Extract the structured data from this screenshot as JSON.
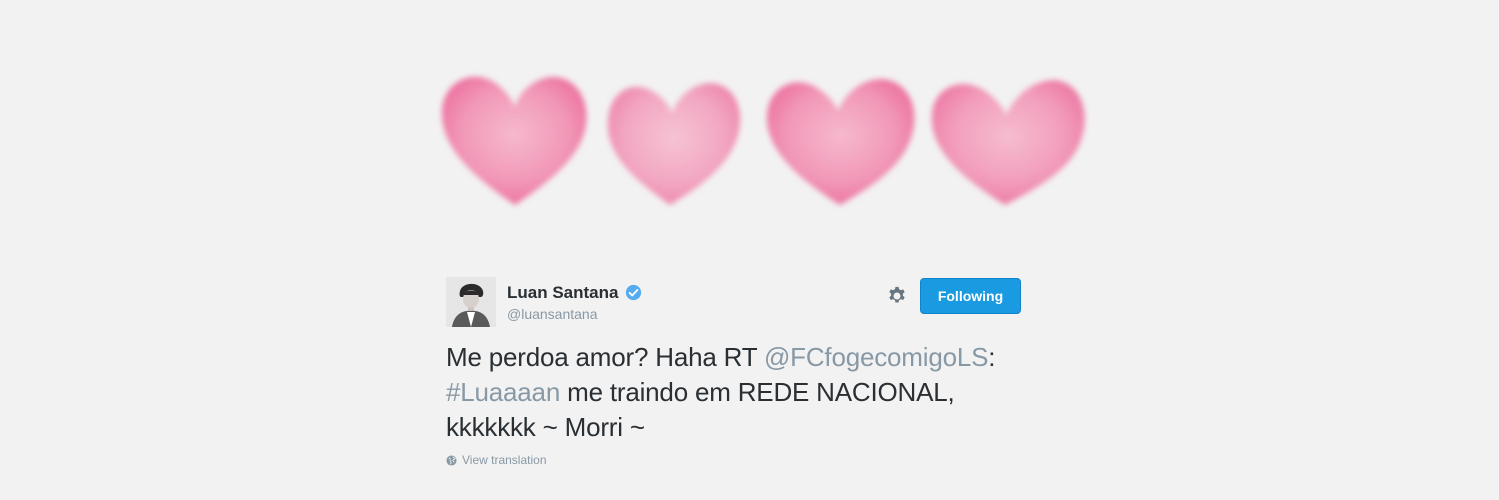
{
  "banner": {
    "hearts": [
      "heart-1",
      "heart-2",
      "heart-3",
      "heart-4"
    ],
    "heart_color": "#f07aa3"
  },
  "tweet": {
    "author": {
      "display_name": "Luan Santana",
      "handle": "@luansantana",
      "verified": true
    },
    "follow_button_label": "Following",
    "text": {
      "part1": "Me perdoa amor? Haha RT ",
      "mention": "@FCfogecomigoLS",
      "part2": ": ",
      "hashtag": "#Luaaaan",
      "part3": " me traindo em REDE NACIONAL,",
      "part4": "kkkkkkk ~ Morri ~"
    },
    "view_translation_label": "View translation"
  },
  "colors": {
    "background": "#f2f2f2",
    "accent": "#1a9ae0",
    "verified": "#55acee",
    "muted": "#8899a6",
    "text": "#292f33"
  }
}
